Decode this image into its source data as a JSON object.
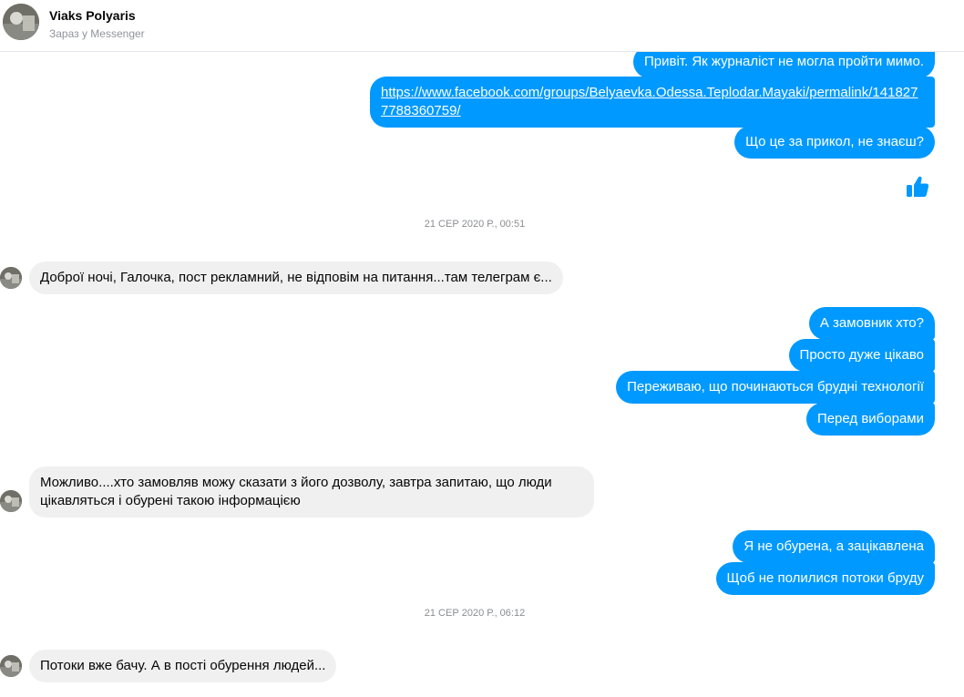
{
  "header": {
    "name": "Viaks Polyaris",
    "status": "Зараз у Messenger"
  },
  "messages": {
    "m1": "Привіт. Як журналіст не могла пройти мимо.",
    "m2": "https://www.facebook.com/groups/Belyaevka.Odessa.Teplodar.Mayaki/permalink/1418277788360759/",
    "m3": "Що це за прикол, не знаєш?",
    "ts1": "21 СЕР 2020 Р., 00:51",
    "m4": "Доброї ночі, Галочка, пост рекламний, не відповім на питання...там телеграм є...",
    "m5": "А замовник хто?",
    "m6": "Просто дуже цікаво",
    "m7": "Переживаю, що починаються брудні технології",
    "m8": "Перед виборами",
    "m9": "Можливо....хто замовляв можу сказати з його дозволу, завтра запитаю, що люди цікавляться і обурені такою інформацією",
    "m10": "Я не обурена, а зацікавлена",
    "m11": "Щоб не полилися потоки бруду",
    "ts2": "21 СЕР 2020 Р., 06:12",
    "m12": "Потоки вже бачу. А в пості обурення людей..."
  },
  "icons": {
    "like": "thumbs-up-icon",
    "avatar": "contact-avatar"
  },
  "colors": {
    "outgoing": "#0099ff",
    "incoming": "#f0f0f0",
    "like": "#0099ff"
  }
}
